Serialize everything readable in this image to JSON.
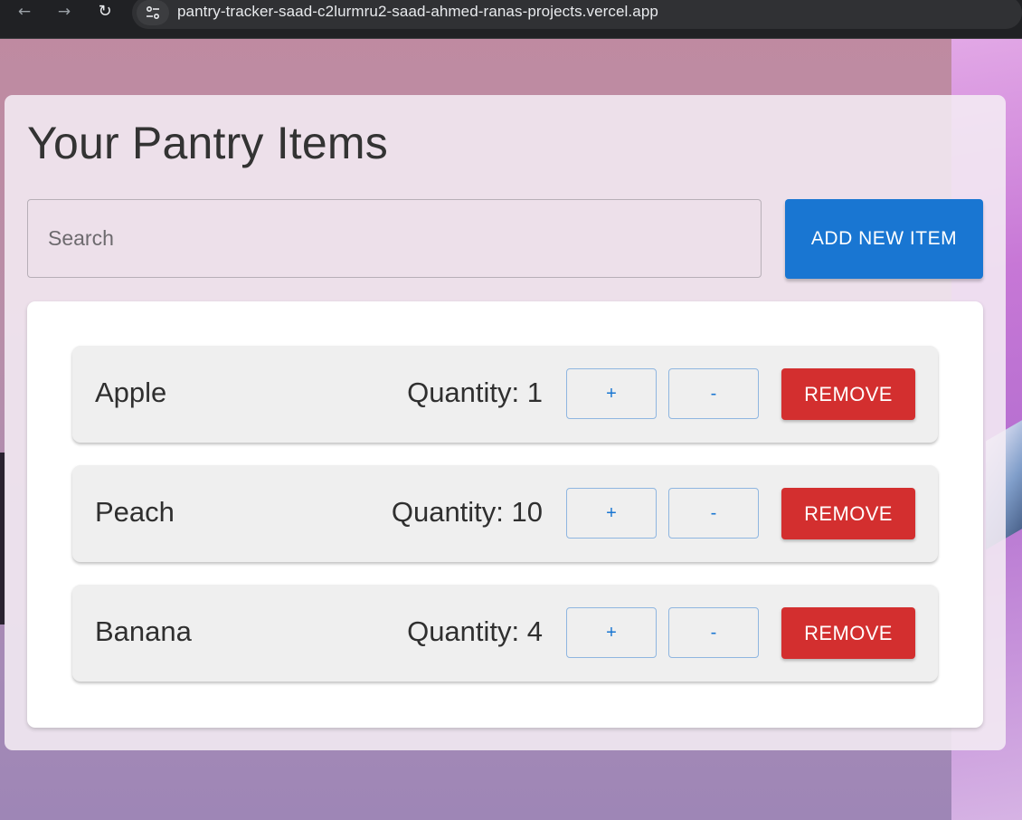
{
  "browser": {
    "url": "pantry-tracker-saad-c2lurmru2-saad-ahmed-ranas-projects.vercel.app",
    "back_icon": "arrow-left-icon",
    "forward_icon": "arrow-right-icon",
    "reload_icon": "reload-icon",
    "site_info_icon": "tune-icon"
  },
  "page": {
    "title": "Your Pantry Items",
    "search_placeholder": "Search",
    "add_button_label": "ADD NEW ITEM"
  },
  "colors": {
    "primary": "#1976d2",
    "danger": "#d32f2f"
  },
  "items": [
    {
      "name": "Apple",
      "quantity_label": "Quantity: 1",
      "plus_label": "+",
      "minus_label": "-",
      "remove_label": "REMOVE"
    },
    {
      "name": "Peach",
      "quantity_label": "Quantity: 10",
      "plus_label": "+",
      "minus_label": "-",
      "remove_label": "REMOVE"
    },
    {
      "name": "Banana",
      "quantity_label": "Quantity: 4",
      "plus_label": "+",
      "minus_label": "-",
      "remove_label": "REMOVE"
    }
  ]
}
